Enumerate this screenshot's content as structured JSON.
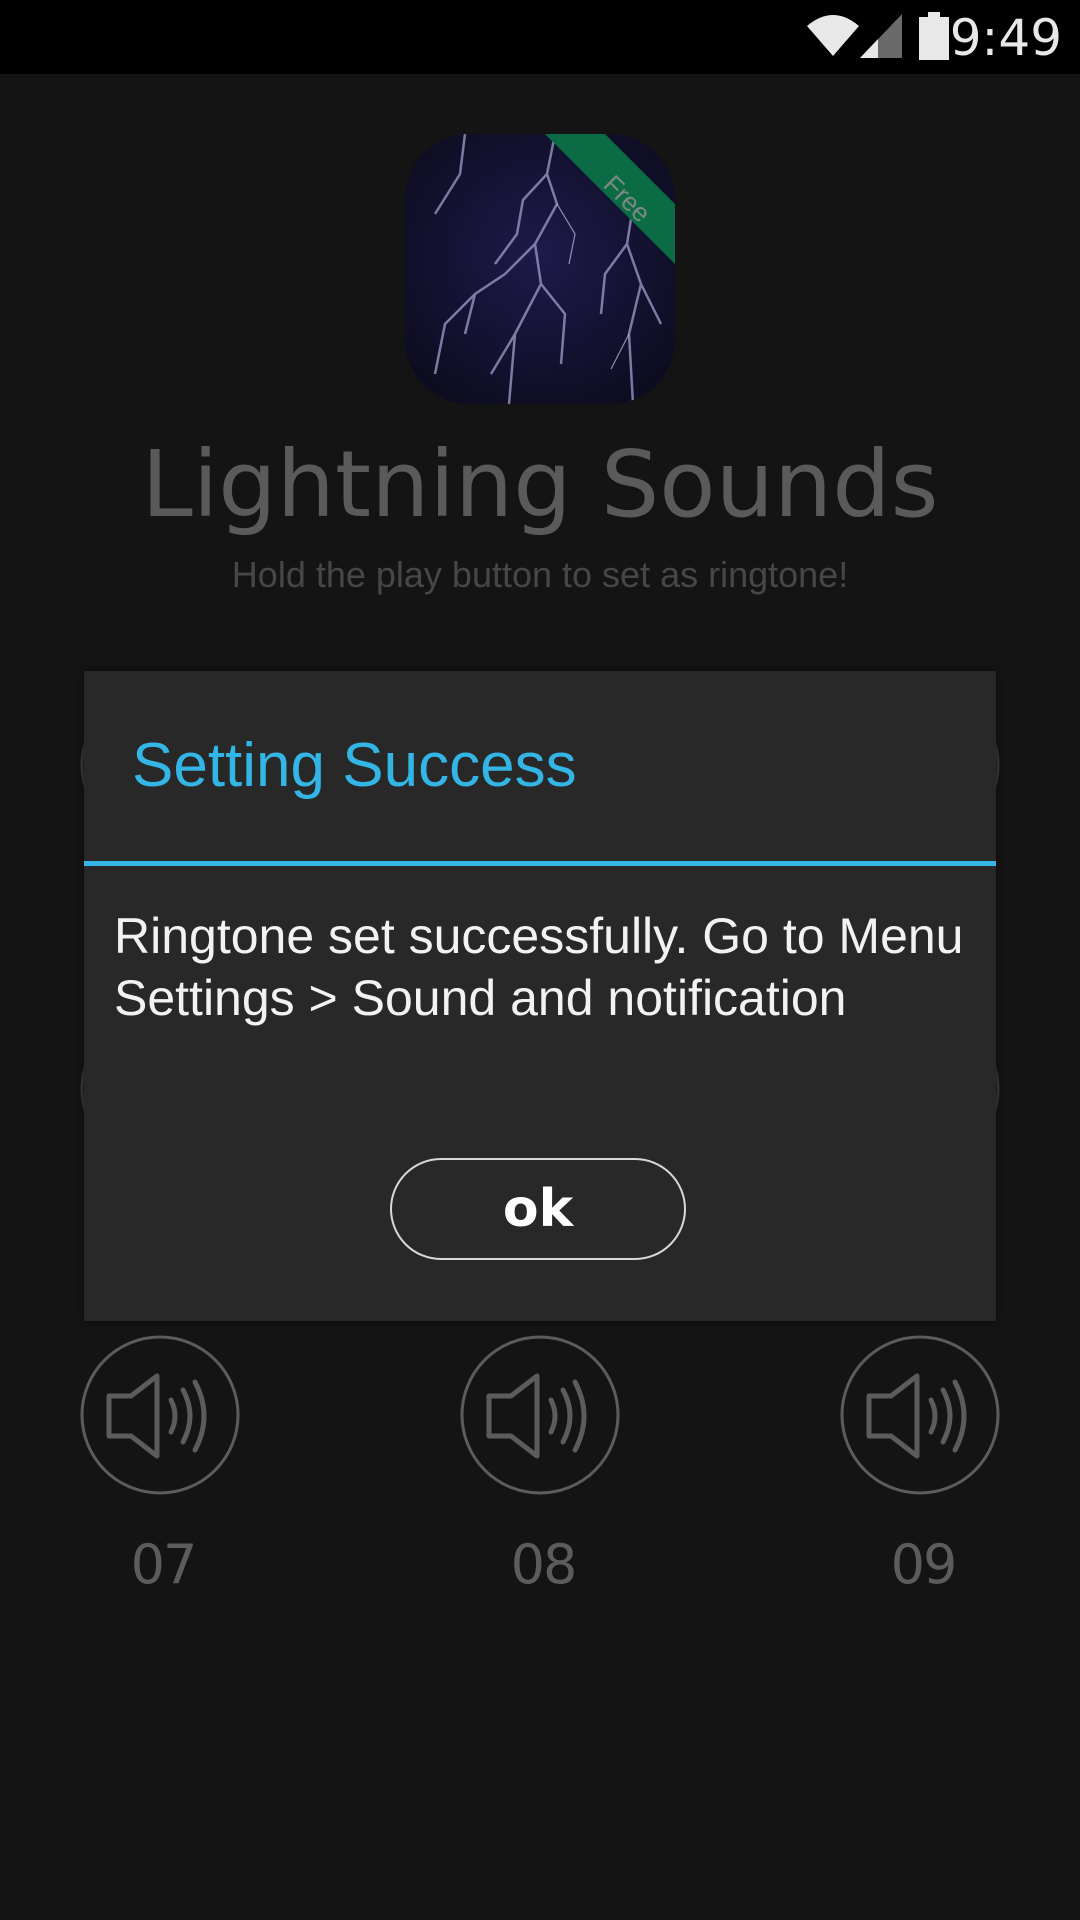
{
  "status_bar": {
    "time": "9:49",
    "icons": [
      "wifi-icon",
      "cell-signal-icon",
      "battery-icon"
    ]
  },
  "app": {
    "icon_badge": "Free",
    "title": "Lightning Sounds",
    "subtitle": "Hold the play button to set as ringtone!",
    "sounds": [
      {
        "label": "07",
        "icon": "speaker-icon"
      },
      {
        "label": "08",
        "icon": "speaker-icon"
      },
      {
        "label": "09",
        "icon": "speaker-icon"
      }
    ]
  },
  "dialog": {
    "title": "Setting Success",
    "message": "Ringtone set successfully. Go to Menu Settings > Sound and notification",
    "ok_label": "ok"
  },
  "colors": {
    "accent": "#33b5e5",
    "background": "#141414",
    "dialog": "#282828",
    "badge": "#0b6b45"
  }
}
